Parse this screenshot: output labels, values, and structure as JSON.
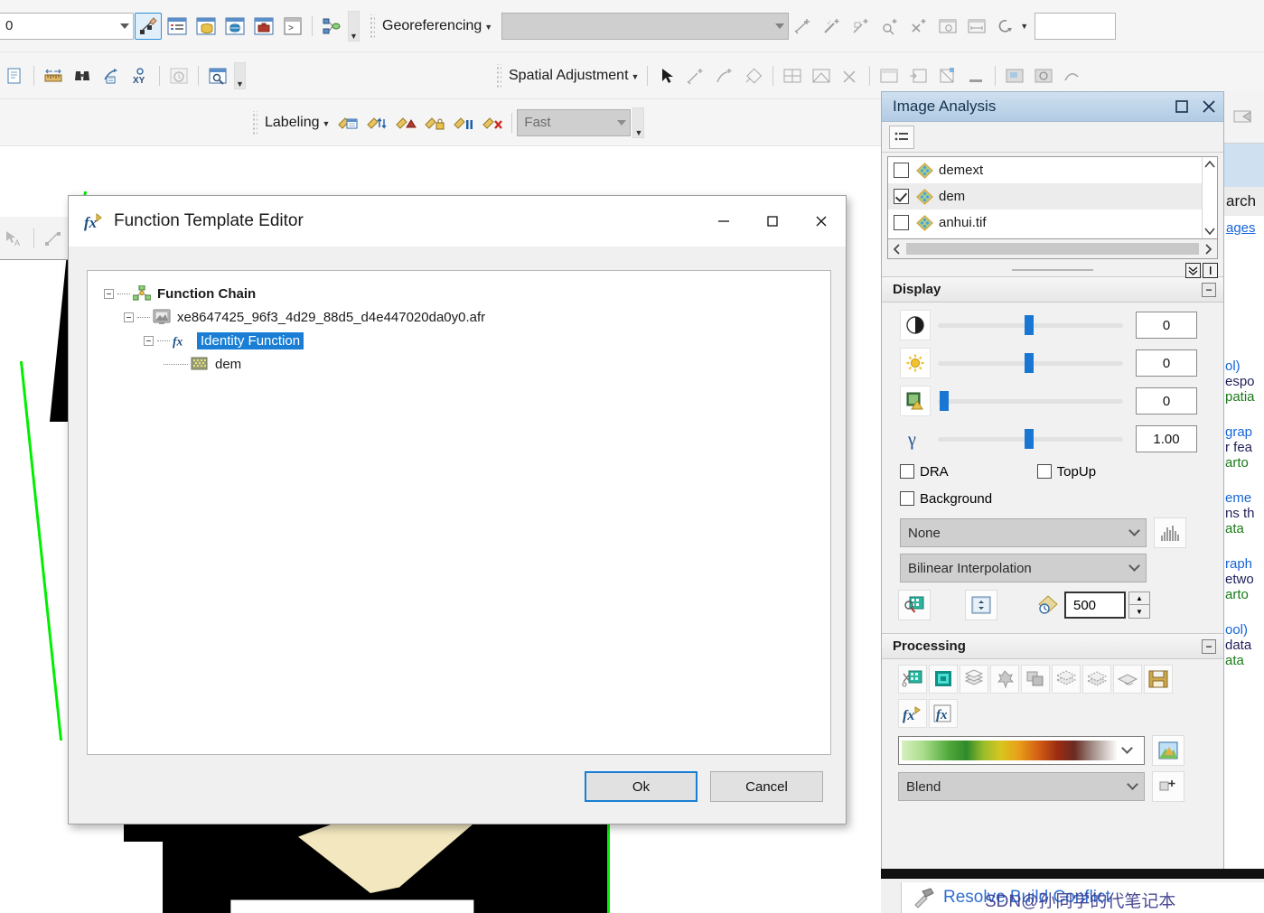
{
  "app": {
    "toolbars": {
      "row1": {
        "scale_combo_value": "0",
        "label": "Georeferencing",
        "georef_combo_value": "",
        "buttons": [
          {
            "name": "edit-tool",
            "icon": "edit-vertices-icon",
            "active": true
          },
          {
            "name": "attribute-table",
            "icon": "table-icon"
          },
          {
            "name": "catalog",
            "icon": "database-icon"
          },
          {
            "name": "search-globe",
            "icon": "globe-window-icon"
          },
          {
            "name": "arctoolbox",
            "icon": "toolbox-icon"
          },
          {
            "name": "python-window",
            "icon": "python-console-icon"
          },
          {
            "name": "model-builder",
            "icon": "modelbuilder-icon"
          }
        ],
        "georef_buttons": [
          {
            "name": "add-control-points",
            "icon": "add-control-point-icon"
          },
          {
            "name": "auto-register",
            "icon": "magic-register-icon"
          },
          {
            "name": "view-link-table",
            "icon": "link-table-icon"
          },
          {
            "name": "zoom-to-links",
            "icon": "zoom-link-icon"
          },
          {
            "name": "delete-link",
            "icon": "delete-link-icon"
          },
          {
            "name": "fit-to-display",
            "icon": "fit-display-icon"
          },
          {
            "name": "update-georeferencing",
            "icon": "update-georef-icon"
          },
          {
            "name": "rotate",
            "icon": "rotate-icon"
          }
        ],
        "rotation_value": ""
      },
      "row2": {
        "label": "Spatial Adjustment",
        "buttons": [
          {
            "name": "identify",
            "icon": "identify-icon"
          },
          {
            "name": "measure",
            "icon": "ruler-icon"
          },
          {
            "name": "find",
            "icon": "binoculars-icon"
          },
          {
            "name": "find-route",
            "icon": "route-icon"
          },
          {
            "name": "go-to-xy",
            "icon": "xy-icon"
          },
          {
            "name": "time-slider",
            "icon": "clock-icon"
          },
          {
            "name": "create-viewer-window",
            "icon": "viewer-window-icon"
          }
        ],
        "sa_buttons": [
          {
            "name": "select-elements",
            "icon": "arrow-pointer-icon"
          },
          {
            "name": "new-displacement-link",
            "icon": "displacement-link-icon"
          },
          {
            "name": "new-multi-displacement-link",
            "icon": "multi-link-icon"
          },
          {
            "name": "new-identity-link",
            "icon": "identity-link-icon"
          },
          {
            "name": "edit-attribute",
            "icon": "grid-attribute-icon"
          },
          {
            "name": "adjust",
            "icon": "adjust-icon"
          },
          {
            "name": "delete-links",
            "icon": "delete-links-icon"
          },
          {
            "name": "table-window",
            "icon": "table-window-icon"
          },
          {
            "name": "link-table",
            "icon": "link-table2-icon"
          },
          {
            "name": "snap-settings",
            "icon": "snap-icon"
          },
          {
            "name": "more",
            "icon": "more-icon"
          }
        ]
      },
      "row3": {
        "label": "Labeling",
        "quality_combo_value": "Fast",
        "buttons": [
          {
            "name": "label-manager",
            "icon": "label-manager-icon"
          },
          {
            "name": "label-priority-ranking",
            "icon": "label-priority-icon"
          },
          {
            "name": "label-weight-ranking",
            "icon": "label-weight-icon"
          },
          {
            "name": "lock-labels",
            "icon": "label-lock-icon"
          },
          {
            "name": "pause-labeling",
            "icon": "label-pause-icon"
          },
          {
            "name": "view-unplaced-labels",
            "icon": "label-unplaced-icon"
          }
        ]
      }
    }
  },
  "dialog": {
    "title": "Function Template Editor",
    "title_icon": "function-editor-icon",
    "window_controls": {
      "minimize": "minimize-icon",
      "maximize": "maximize-icon",
      "close": "close-icon"
    },
    "tree": [
      {
        "label": "Function Chain",
        "icon": "function-chain-icon",
        "depth": 0,
        "bold": true,
        "expandable": true,
        "selected": false
      },
      {
        "label": "xe8647425_96f3_4d29_88d5_d4e447020da0y0.afr",
        "icon": "raster-dataset-icon",
        "depth": 1,
        "bold": false,
        "expandable": true,
        "selected": false
      },
      {
        "label": "Identity Function",
        "icon": "fx-icon",
        "depth": 2,
        "bold": false,
        "expandable": true,
        "selected": true
      },
      {
        "label": "dem",
        "icon": "raster-grid-icon",
        "depth": 3,
        "bold": false,
        "expandable": false,
        "selected": false
      }
    ],
    "buttons": {
      "ok": "Ok",
      "cancel": "Cancel"
    }
  },
  "image_analysis": {
    "title": "Image Analysis",
    "title_controls": {
      "float": "float-icon",
      "close": "close-icon"
    },
    "toolbar_buttons": [
      {
        "name": "options",
        "icon": "options-list-icon"
      }
    ],
    "layers": [
      {
        "name": "demext",
        "checked": false,
        "selected": false,
        "icon": "raster-layer-icon"
      },
      {
        "name": "dem",
        "checked": true,
        "selected": true,
        "icon": "raster-layer-icon"
      },
      {
        "name": "anhui.tif",
        "checked": false,
        "selected": false,
        "icon": "raster-layer-icon"
      }
    ],
    "scroll": {
      "up": "scroll-up-icon",
      "down": "scroll-down-icon",
      "left": "scroll-left-icon",
      "right": "scroll-right-icon"
    },
    "splitter_buttons": [
      {
        "name": "collapse-all",
        "icon": "double-chevron-down-icon"
      },
      {
        "name": "restore",
        "icon": "bar-icon"
      }
    ],
    "display": {
      "header": "Display",
      "collapse_icon": "minus-icon",
      "sliders": [
        {
          "name": "contrast",
          "icon": "contrast-icon",
          "value": "0",
          "thumb_pct": 48
        },
        {
          "name": "brightness",
          "icon": "brightness-icon",
          "value": "0",
          "thumb_pct": 48
        },
        {
          "name": "transparency",
          "icon": "transparency-icon",
          "value": "0",
          "thumb_pct": 2
        },
        {
          "name": "gamma",
          "icon": "gamma-icon",
          "value": "1.00",
          "thumb_pct": 48
        }
      ],
      "checkboxes": [
        {
          "label": "DRA",
          "checked": false
        },
        {
          "label": "TopUp",
          "checked": false
        },
        {
          "label": "Background",
          "checked": false
        }
      ],
      "stretch_combo": "None",
      "histogram_button_icon": "histogram-icon",
      "resample_combo": "Bilinear Interpolation",
      "tool_buttons": [
        {
          "name": "zoom-to-raster-resolution",
          "icon": "zoom-raster-icon"
        },
        {
          "name": "swipe-layer",
          "icon": "swipe-icon"
        },
        {
          "name": "flicker-layer",
          "icon": "flicker-icon"
        }
      ],
      "flicker_value": "500",
      "spinner_icons": {
        "up": "spin-up-icon",
        "down": "spin-down-icon"
      }
    },
    "processing": {
      "header": "Processing",
      "collapse_icon": "minus-icon",
      "buttons": [
        {
          "name": "clip",
          "icon": "clip-icon"
        },
        {
          "name": "mask",
          "icon": "mask-icon"
        },
        {
          "name": "mosaic",
          "icon": "mosaic-icon"
        },
        {
          "name": "ndvi",
          "icon": "leaf-ndvi-icon"
        },
        {
          "name": "pan-sharpen",
          "icon": "pansharpen-icon"
        },
        {
          "name": "shaded-relief",
          "icon": "shaded-relief-icon"
        },
        {
          "name": "hillshade",
          "icon": "hillshade-icon"
        },
        {
          "name": "slope",
          "icon": "slope-icon"
        },
        {
          "name": "save-layer",
          "icon": "save-floppy-icon"
        },
        {
          "name": "edit-function",
          "icon": "edit-function-icon"
        },
        {
          "name": "add-function",
          "icon": "add-function-icon"
        }
      ],
      "color_ramp_name": "elevation-color-ramp",
      "color_ramp_button_icon": "image-preview-icon",
      "blend_combo": "Blend",
      "blend_side_icon": "add-band-icon"
    }
  },
  "search_results_edge": {
    "fragments": [
      "ol)",
      "espo",
      "patia",
      "grap",
      "r fea",
      "arto",
      "eme",
      "ns th",
      "ata",
      "raph",
      "etwo",
      "arto",
      "ool)",
      "data",
      "ata"
    ],
    "top_label": "arch",
    "link_label": "ages"
  },
  "statusbar": {
    "icon": "hammer-icon",
    "text": "Resolve Build Conflict",
    "watermark": "SDN@孙同学的代笔记本"
  }
}
